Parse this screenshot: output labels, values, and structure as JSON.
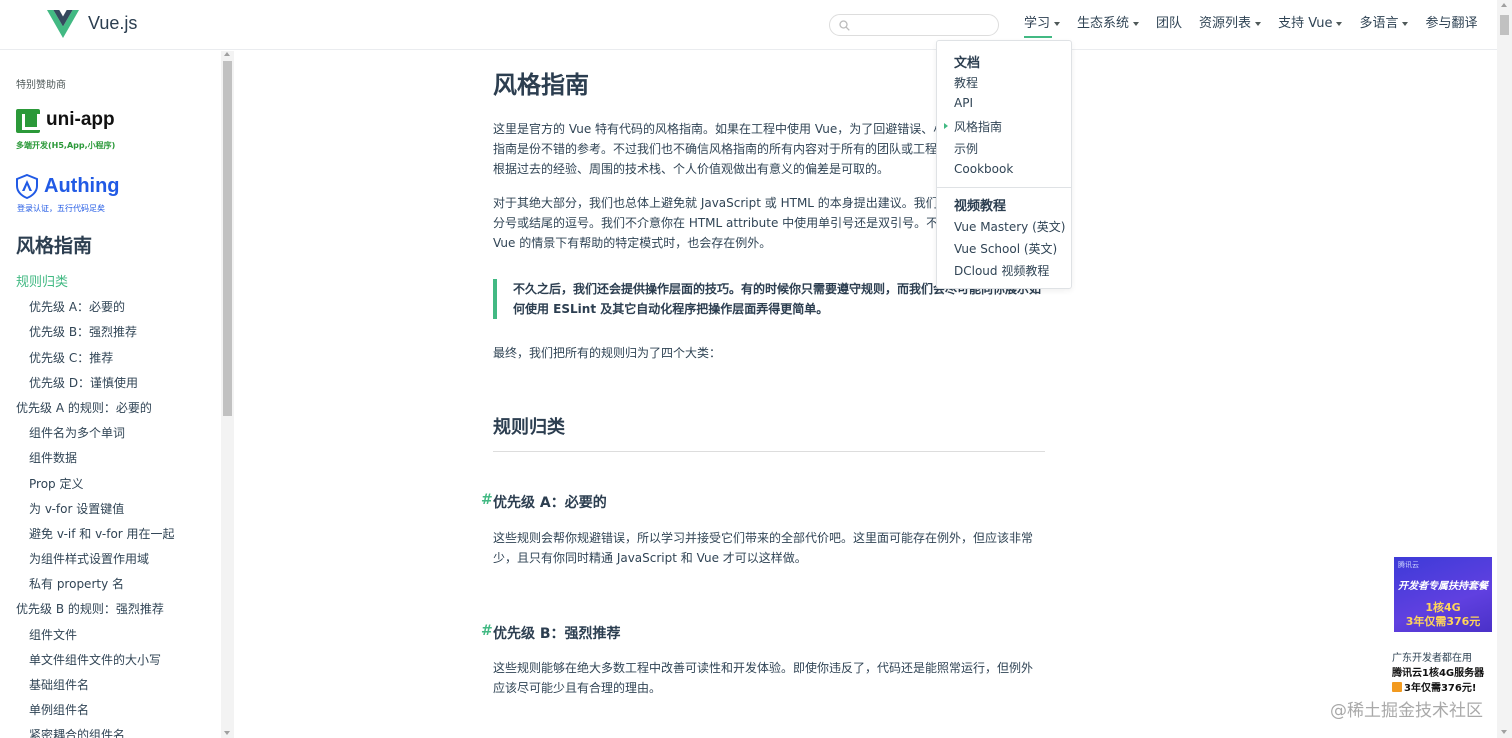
{
  "header": {
    "brand": "Vue.js",
    "search": {
      "placeholder": ""
    },
    "nav": [
      {
        "label": "学习",
        "dropdown": true
      },
      {
        "label": "生态系统",
        "dropdown": true
      },
      {
        "label": "团队",
        "dropdown": false
      },
      {
        "label": "资源列表",
        "dropdown": true
      },
      {
        "label": "支持 Vue",
        "dropdown": true
      },
      {
        "label": "多语言",
        "dropdown": true
      },
      {
        "label": "参与翻译",
        "dropdown": false
      }
    ]
  },
  "dropdown": {
    "group1_title": "文档",
    "group1_items": [
      "教程",
      "API",
      "风格指南",
      "示例",
      "Cookbook"
    ],
    "group2_title": "视频教程",
    "group2_items": [
      "Vue Mastery (英文)",
      "Vue School (英文)",
      "DCloud 视频教程"
    ]
  },
  "sidebar": {
    "sponsor_label": "特别赞助商",
    "uni_name": "uni-app",
    "uni_sub": "多端开发(H5,App,小程序)",
    "auth_name": "Authing",
    "auth_sub": "登录认证，五行代码足矣",
    "title": "风格指南",
    "items": [
      {
        "label": "规则归类",
        "level": 0
      },
      {
        "label": "优先级 A：必要的",
        "level": 1
      },
      {
        "label": "优先级 B：强烈推荐",
        "level": 1
      },
      {
        "label": "优先级 C：推荐",
        "level": 1
      },
      {
        "label": "优先级 D：谨慎使用",
        "level": 1
      },
      {
        "label": "优先级 A 的规则：必要的",
        "level": 0
      },
      {
        "label": "组件名为多个单词",
        "level": 1
      },
      {
        "label": "组件数据",
        "level": 1
      },
      {
        "label": "Prop 定义",
        "level": 1
      },
      {
        "label": "为 v-for 设置键值",
        "level": 1
      },
      {
        "label": "避免 v-if 和 v-for 用在一起",
        "level": 1
      },
      {
        "label": "为组件样式设置作用域",
        "level": 1
      },
      {
        "label": "私有 property 名",
        "level": 1
      },
      {
        "label": "优先级 B 的规则：强烈推荐",
        "level": 0
      },
      {
        "label": "组件文件",
        "level": 1
      },
      {
        "label": "单文件组件文件的大小写",
        "level": 1
      },
      {
        "label": "基础组件名",
        "level": 1
      },
      {
        "label": "单例组件名",
        "level": 1
      },
      {
        "label": "紧密耦合的组件名",
        "level": 1
      }
    ]
  },
  "content": {
    "title": "风格指南",
    "p1": "这里是官方的 Vue 特有代码的风格指南。如果在工程中使用 Vue，为了回避错误、小纠结和反模式，该指南是份不错的参考。不过我们也不确信风格指南的所有内容对于所有的团队或工程都是理想的。所以根据过去的经验、周围的技术栈、个人价值观做出有意义的偏差是可取的。",
    "p2": "对于其绝大部分，我们也总体上避免就 JavaScript 或 HTML 的本身提出建议。我们不介意你是否使用分号或结尾的逗号。我们不介意你在 HTML attribute 中使用单引号还是双引号。不过当我们发现在 Vue 的情景下有帮助的特定模式时，也会存在例外。",
    "tip": "不久之后，我们还会提供操作层面的技巧。有的时候你只需要遵守规则，而我们会尽可能向你展示如何使用 ESLint 及其它自动化程序把操作层面弄得更简单。",
    "p3": "最终，我们把所有的规则归为了四个大类：",
    "h2": "规则归类",
    "h3a": "优先级 A：必要的",
    "p4": "这些规则会帮你规避错误，所以学习并接受它们带来的全部代价吧。这里面可能存在例外，但应该非常少，且只有你同时精通 JavaScript 和 Vue 才可以这样做。",
    "h3b": "优先级 B：强烈推荐",
    "p5": "这些规则能够在绝大多数工程中改善可读性和开发体验。即使你违反了，代码还是能照常运行，但例外应该尽可能少且有合理的理由。",
    "hash": "#"
  },
  "ad": {
    "brand": "腾讯云",
    "line1": "开发者专属扶持套餐",
    "line2": "1核4G",
    "line3": "3年仅需376元",
    "text1": "广东开发者都在用",
    "text2": "腾讯云1核4G服务器",
    "text3": "3年仅需376元!"
  },
  "watermark": "@稀土掘金技术社区",
  "colors": {
    "accent": "#42b983",
    "text": "#2c3e50",
    "uni": "#2b9939",
    "authing": "#215ae5"
  }
}
